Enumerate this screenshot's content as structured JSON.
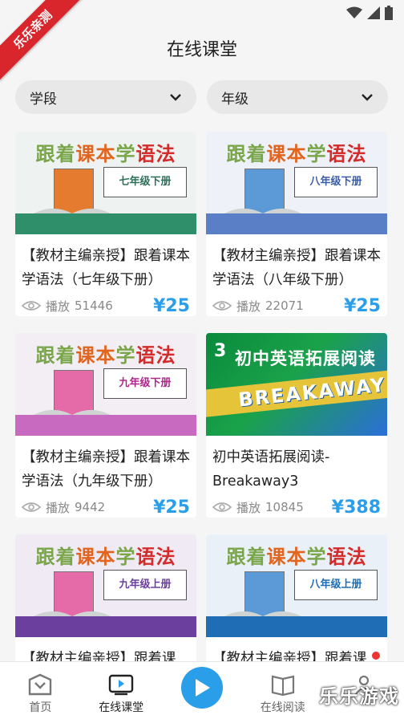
{
  "ribbon": "乐乐亲测",
  "title": "在线课堂",
  "filters": [
    {
      "label": "学段"
    },
    {
      "label": "年级"
    }
  ],
  "cards": [
    {
      "cover_grade": "七年级下册",
      "title": "【教材主编亲授】跟着课本学语法（七年级下册）",
      "plays_label": "播放",
      "plays": "51446",
      "price": "¥25"
    },
    {
      "cover_grade": "八年级下册",
      "title": "【教材主编亲授】跟着课本学语法（八年级下册）",
      "plays_label": "播放",
      "plays": "22071",
      "price": "¥25"
    },
    {
      "cover_grade": "九年级下册",
      "title": "【教材主编亲授】跟着课本学语法（九年级下册）",
      "plays_label": "播放",
      "plays": "9442",
      "price": "¥25"
    },
    {
      "cover_num": "3",
      "cover_head": "初中英语拓展阅读",
      "cover_word": "BREAKAWAY",
      "title": "初中英语拓展阅读-Breakaway3",
      "plays_label": "播放",
      "plays": "10845",
      "price": "¥388"
    },
    {
      "cover_grade": "九年级上册",
      "title": "【教材主编亲授】跟着课",
      "plays_label": "",
      "plays": "",
      "price": ""
    },
    {
      "cover_grade": "八年级上册",
      "title": "【教材主编亲授】跟着课",
      "plays_label": "",
      "plays": "",
      "price": ""
    }
  ],
  "cover_series": {
    "part1": "跟着",
    "part2": "课本",
    "part3": "学",
    "part4": "语法"
  },
  "nav": [
    {
      "label": "首页"
    },
    {
      "label": "在线课堂"
    },
    {
      "label": ""
    },
    {
      "label": "在线阅读"
    },
    {
      "label": ""
    }
  ],
  "watermark": "乐乐游戏",
  "colors": {
    "accent": "#2a9ee8",
    "ribbon": "#d8262c",
    "band_green": "#2f8f6b",
    "band_blue": "#5b7fc7",
    "band_pink": "#c86bc0",
    "band_purple": "#6a3f9e",
    "band_darkblue": "#1f6db4"
  }
}
